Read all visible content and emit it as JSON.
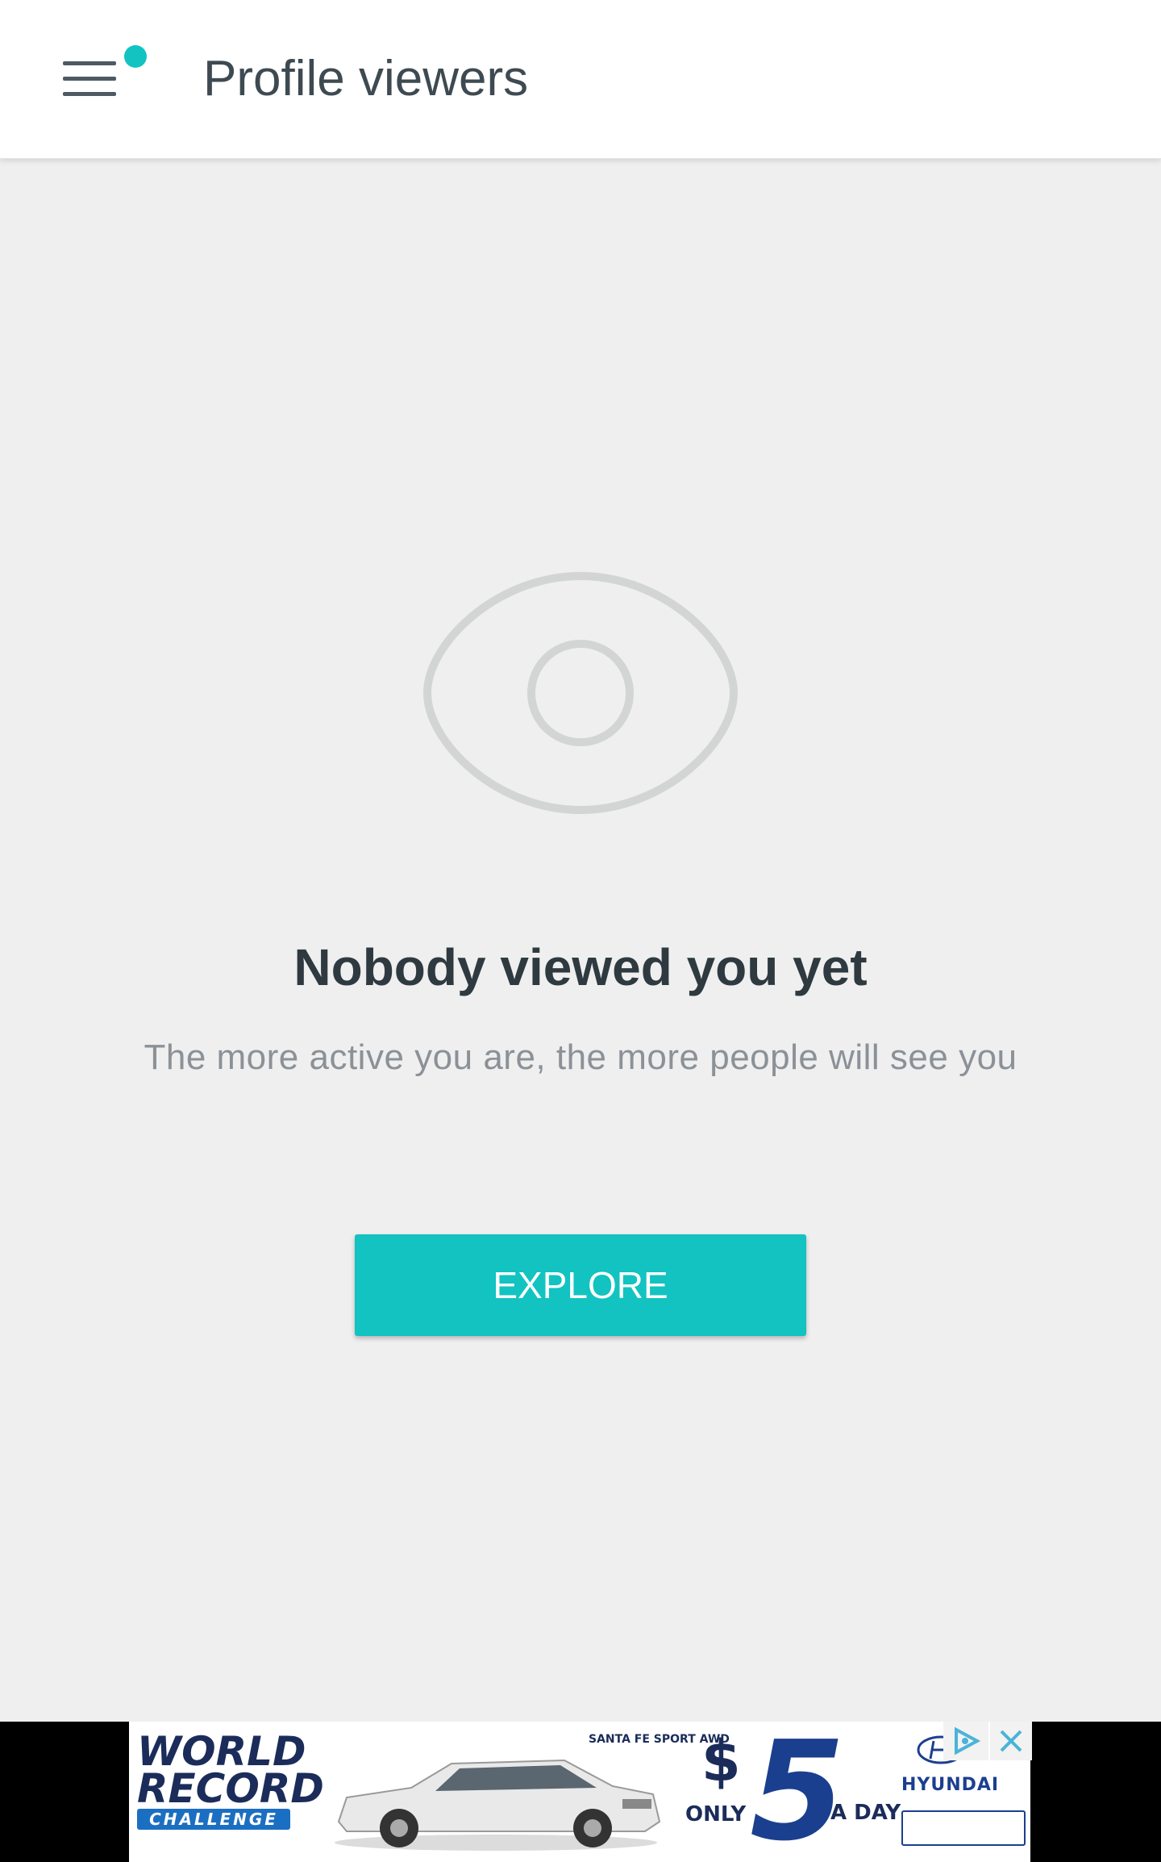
{
  "header": {
    "title": "Profile viewers",
    "menu_icon": "hamburger-menu-icon",
    "notification_dot_color": "#12c3c1"
  },
  "empty_state": {
    "icon": "eye-icon",
    "headline": "Nobody viewed you yet",
    "subtext": "The more active you are, the more people will see you",
    "button_label": "EXPLORE"
  },
  "colors": {
    "accent": "#12c3c1",
    "background": "#efefef",
    "header_bg": "#ffffff",
    "eye_icon": "#d2d5d4"
  },
  "ad": {
    "headline_line1": "WORLD",
    "headline_line2": "RECORD",
    "headline_line3": "CHALLENGE",
    "tagline": "SANTA FE SPORT AWD",
    "price_symbol": "$",
    "price_value": "5",
    "price_prefix": "ONLY",
    "price_suffix": "A DAY",
    "brand": "HYUNDAI",
    "adchoices_icon": "adchoices-icon",
    "close_icon": "close-icon"
  }
}
